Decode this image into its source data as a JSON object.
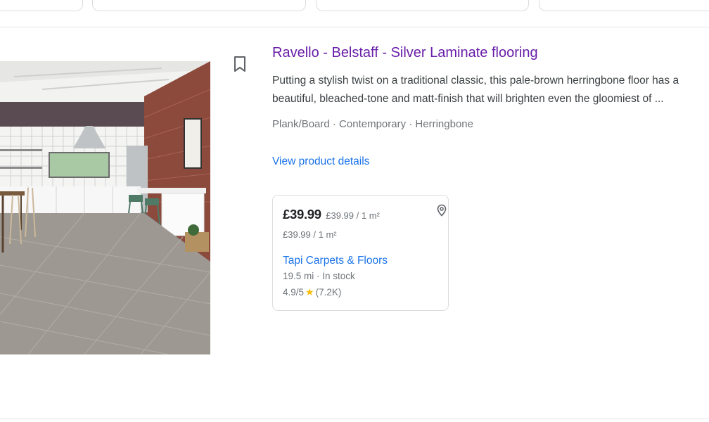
{
  "product": {
    "title": "Ravello - Belstaff - Silver Laminate flooring",
    "description": "Putting a stylish twist on a traditional classic, this pale-brown herringbone floor has a beautiful, bleached-tone and matt-finish that will brighten even the gloomiest of ...",
    "tags": "Plank/Board · Contemporary · Herringbone",
    "details_link": "View product details",
    "image_icon": "kitchen-herringbone-floor-image",
    "bookmark_icon": "bookmark-icon"
  },
  "offer": {
    "price": "£39.99",
    "unit_price_inline": "£39.99 / 1 m²",
    "unit_price": "£39.99 / 1 m²",
    "merchant": "Tapi Carpets & Floors",
    "distance_stock": "19.5 mi · In stock",
    "rating": "4.9/5",
    "rating_count": "(7.2K)",
    "pin_icon": "location-pin-icon",
    "star_icon": "star-icon"
  },
  "colors": {
    "title_visited": "#681da8",
    "link": "#1a73e8",
    "muted": "#70757a",
    "star": "#fbbc04"
  }
}
